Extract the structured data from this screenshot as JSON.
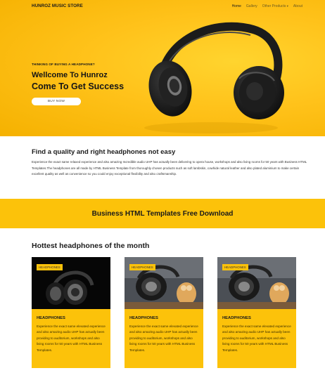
{
  "nav": {
    "brand": "HUNROZ MUSIC STORE",
    "items": [
      {
        "label": "Home",
        "active": true
      },
      {
        "label": "Gallery",
        "active": false
      },
      {
        "label": "Other Products",
        "active": false,
        "dropdown": true
      },
      {
        "label": "About",
        "active": false
      }
    ]
  },
  "hero": {
    "kicker": "THINKING OF BUYING A HEADPHONE?",
    "headline_1": "Wellcome To Hunroz",
    "headline_2": "Come To Get Success",
    "button": "BUY NOW",
    "background_color": "#ffc21a"
  },
  "about": {
    "title": "Find a quality and right headphones not easy",
    "body": "Experience the exact same relaxed experience and also amazing Incredible audio UHP has actually been delivering to opera house, workshops and also living rooms for 50 years with Business HTML Templates.The headphones are all made by HTML Business Template from thoroughly chosen products such as soft lambskin, cowhide natural leather and also plated aluminium to make certain excellent quality as well as convenience so you could enjoy exceptional flexibility and also craftsmanship."
  },
  "banner": {
    "text": "Business HTML Templates Free Download",
    "color": "#fcc20a"
  },
  "products": {
    "title": "Hottest headphones of the month",
    "cards": [
      {
        "badge": "HEADPHONES",
        "name": "HEADPHONES",
        "description": "Experience the exact same elevated experience and also amazing audio UHP has actually been providing to auditorium, workshops and also living rooms for 50 years with HTML Business Templates."
      },
      {
        "badge": "HEADPHONES",
        "name": "HEADPHONES",
        "description": "Experience the exact same elevated experience and also amazing audio UHP has actually been providing to auditorium, workshops and also living rooms for 50 years with HTML Business Templates."
      },
      {
        "badge": "HEADPHONES",
        "name": "HEADPHONES",
        "description": "Experience the exact same elevated experience and also amazing audio UHP has actually been providing to auditorium, workshops and also living rooms for 50 years with HTML Business Templates."
      }
    ]
  }
}
